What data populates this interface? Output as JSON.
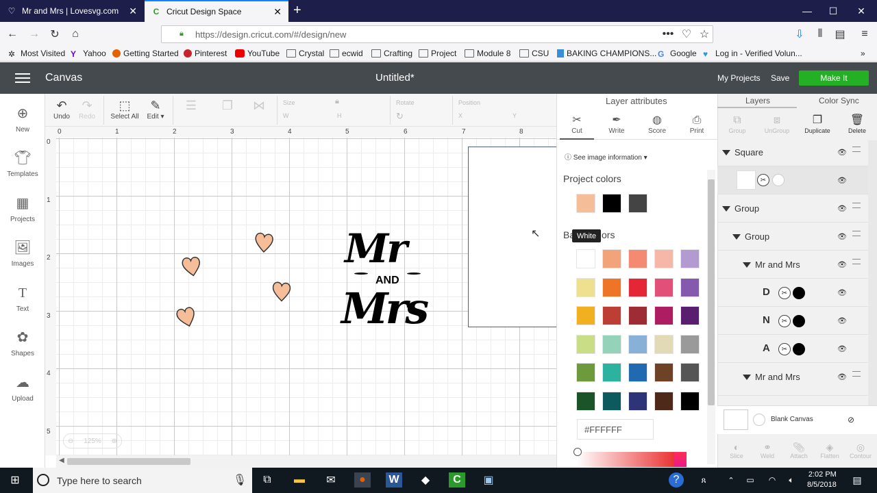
{
  "browser": {
    "tabs": [
      {
        "title": "Mr and Mrs | Lovesvg.com",
        "active": false
      },
      {
        "title": "Cricut Design Space",
        "active": true
      }
    ],
    "url": "https://design.cricut.com/#/design/new",
    "bookmarks": [
      "Most Visited",
      "Yahoo",
      "Getting Started",
      "Pinterest",
      "YouTube",
      "Crystal",
      "ecwid",
      "Crafting",
      "Project",
      "Module 8",
      "CSU",
      "BAKING CHAMPIONS...",
      "Google",
      "Log in - Verified Volun..."
    ]
  },
  "header": {
    "section": "Canvas",
    "doc_title": "Untitled*",
    "my_projects": "My Projects",
    "save": "Save",
    "make_it": "Make It"
  },
  "sidebar": {
    "items": [
      {
        "label": "New",
        "icon": "plus-circle-icon"
      },
      {
        "label": "Templates",
        "icon": "tshirt-icon"
      },
      {
        "label": "Projects",
        "icon": "projects-icon"
      },
      {
        "label": "Images",
        "icon": "image-icon"
      },
      {
        "label": "Text",
        "icon": "text-icon"
      },
      {
        "label": "Shapes",
        "icon": "shapes-icon"
      },
      {
        "label": "Upload",
        "icon": "upload-icon"
      }
    ]
  },
  "toolbar": {
    "undo": "Undo",
    "redo": "Redo",
    "select_all": "Select All",
    "edit": "Edit",
    "size": "Size",
    "w": "W",
    "h": "H",
    "rotate": "Rotate",
    "position": "Position",
    "x": "X",
    "y": "Y"
  },
  "canvas": {
    "ruler_x": [
      "0",
      "1",
      "2",
      "3",
      "4",
      "5",
      "6",
      "7",
      "8"
    ],
    "ruler_y": [
      "0",
      "1",
      "2",
      "3",
      "4",
      "5"
    ],
    "zoom": "125%",
    "design_text_top": "Mr",
    "design_text_mid": "AND",
    "design_text_bottom": "Mrs",
    "heart_color": "#F5BE98"
  },
  "attributes": {
    "title": "Layer attributes",
    "tabs": [
      "Cut",
      "Write",
      "Score",
      "Print"
    ],
    "image_info": "See image information",
    "project_colors_label": "Project colors",
    "project_colors": [
      "#F5BE98",
      "#000000",
      "#444444"
    ],
    "basic_colors_label": "Basic colors",
    "tooltip": "White",
    "basic_colors": [
      "#FFFFFF",
      "#F3A37A",
      "#F48A72",
      "#F6B6A8",
      "#B39AD0",
      "#EFE08F",
      "#EE7428",
      "#E42636",
      "#E2507A",
      "#8459AE",
      "#F1B01F",
      "#BC3E34",
      "#9D2C34",
      "#AE1C62",
      "#5A1E6E",
      "#C9DC86",
      "#94D2BA",
      "#88B1D8",
      "#E2D9B6",
      "#9A9A9A",
      "#6E9A3E",
      "#2BB3A0",
      "#1F6AB0",
      "#6E4226",
      "#555555",
      "#1A5428",
      "#0C5A5E",
      "#2D3578",
      "#4E2818",
      "#000000"
    ],
    "hex_value": "#FFFFFF"
  },
  "layers": {
    "tab_layers": "Layers",
    "tab_color_sync": "Color Sync",
    "actions": [
      "Group",
      "UnGroup",
      "Duplicate",
      "Delete"
    ],
    "rows": [
      {
        "label": "Square"
      },
      {
        "label": ""
      },
      {
        "label": "Group"
      },
      {
        "label": "Group"
      },
      {
        "label": "Mr and Mrs"
      },
      {
        "label": "D"
      },
      {
        "label": "N"
      },
      {
        "label": "A"
      },
      {
        "label": "Mr and Mrs"
      }
    ],
    "blank_canvas": "Blank Canvas",
    "bottom_actions": [
      "Slice",
      "Weld",
      "Attach",
      "Flatten",
      "Contour"
    ]
  },
  "taskbar": {
    "search_placeholder": "Type here to search",
    "time": "2:02 PM",
    "date": "8/5/2018"
  }
}
